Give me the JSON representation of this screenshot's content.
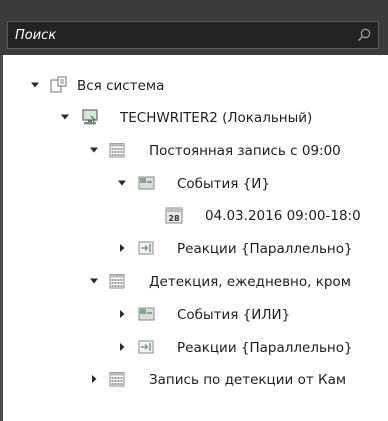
{
  "search": {
    "placeholder": "Поиск"
  },
  "icons": {
    "expanded": "triangle-down",
    "collapsed": "triangle-right",
    "system": "system-icon",
    "computer": "computer-icon",
    "schedule": "calendar-icon",
    "events": "events-icon",
    "reactions": "reactions-icon",
    "date": "date-icon"
  },
  "date_icon_text": "28",
  "tree": [
    {
      "label": "Вся система",
      "icon": "system",
      "state": "expanded"
    },
    {
      "label": "TECHWRITER2 (Локальный)",
      "icon": "computer",
      "state": "expanded"
    },
    {
      "label": "Постоянная запись с 09:00",
      "icon": "schedule",
      "state": "expanded"
    },
    {
      "label": "События {И}",
      "icon": "events",
      "state": "expanded"
    },
    {
      "label": "04.03.2016 09:00-18:0",
      "icon": "date",
      "state": "leaf"
    },
    {
      "label": "Реакции {Параллельно}",
      "icon": "reactions",
      "state": "collapsed"
    },
    {
      "label": "Детекция, ежедневно, кром",
      "icon": "schedule",
      "state": "expanded"
    },
    {
      "label": "События {ИЛИ}",
      "icon": "events",
      "state": "collapsed"
    },
    {
      "label": "Реакции {Параллельно}",
      "icon": "reactions",
      "state": "collapsed"
    },
    {
      "label": "Запись по детекции от Кам",
      "icon": "schedule",
      "state": "collapsed"
    }
  ]
}
